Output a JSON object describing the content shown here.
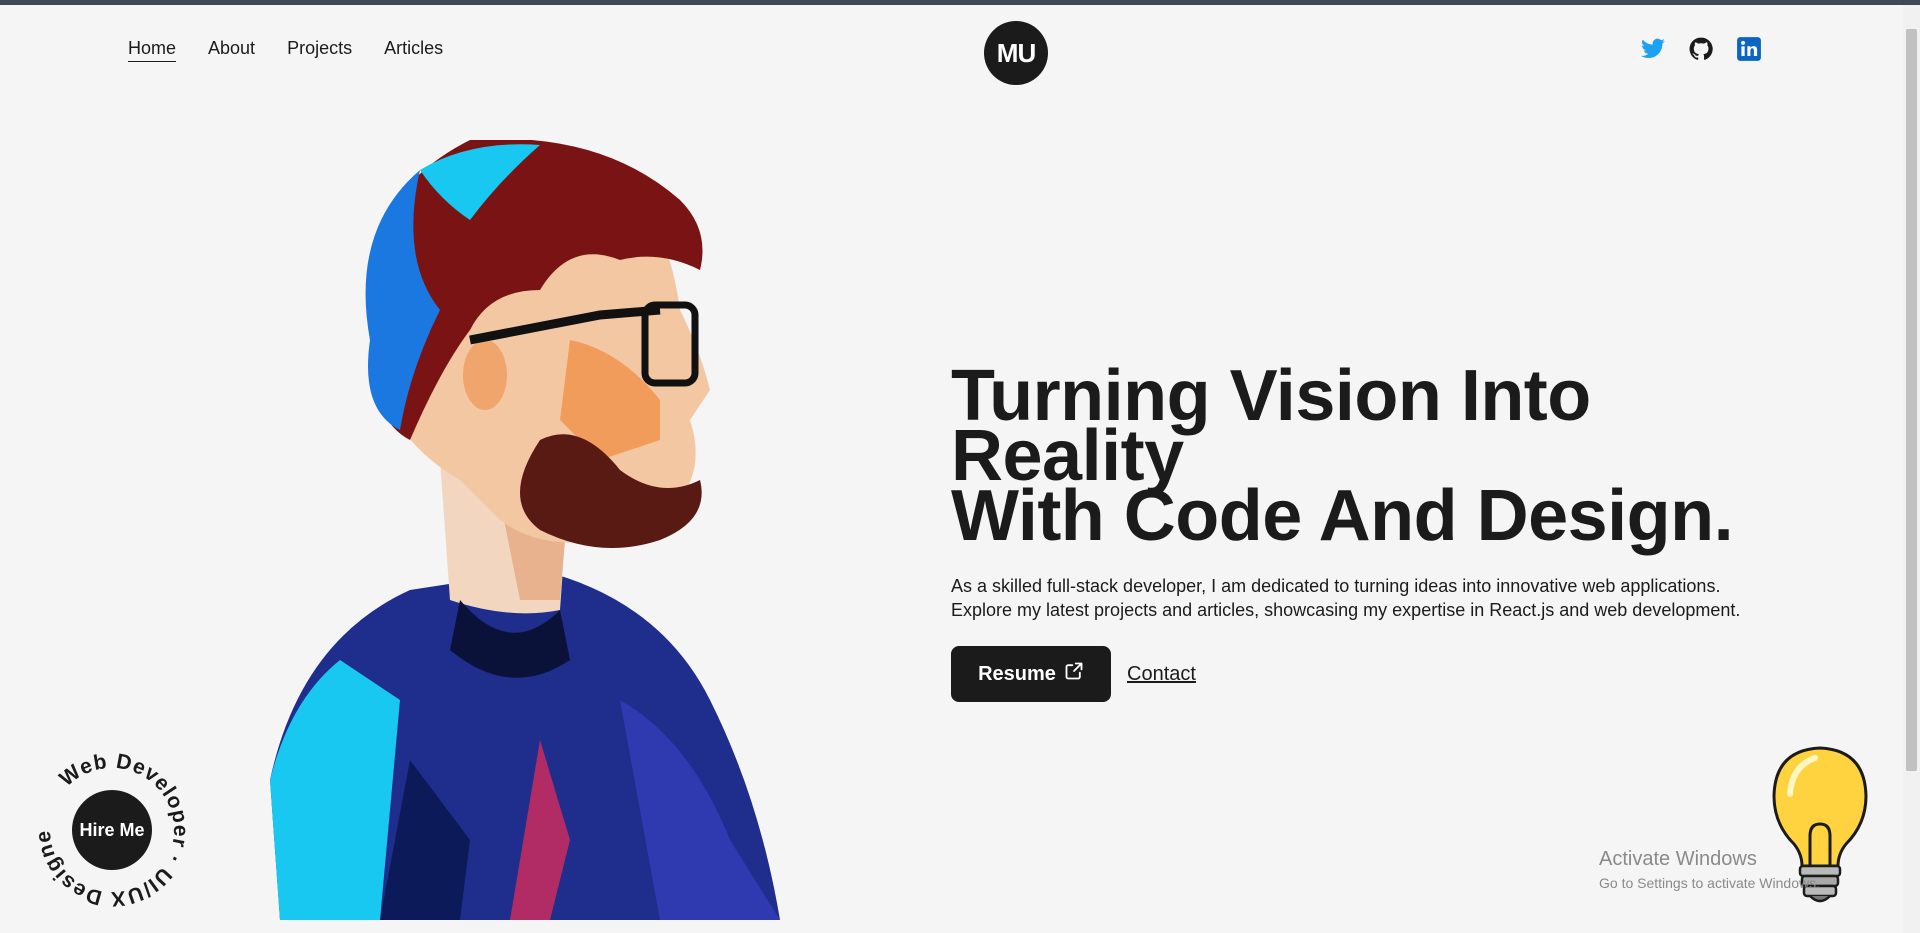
{
  "nav": {
    "items": [
      "Home",
      "About",
      "Projects",
      "Articles"
    ]
  },
  "logo": {
    "text": "MU"
  },
  "socials": [
    "twitter-icon",
    "github-icon",
    "linkedin-icon"
  ],
  "hero": {
    "title_line1": "Turning Vision Into Reality",
    "title_line2": "With Code And Design.",
    "description_line1": "As a skilled full-stack developer, I am dedicated to turning ideas into innovative web applications.",
    "description_line2": "Explore my latest projects and articles, showcasing my expertise in React.js and web development.",
    "resume_label": "Resume",
    "contact_label": "Contact"
  },
  "hire": {
    "center_label": "Hire Me",
    "ring_text": "Web Developer · UI/UX Designer ·"
  },
  "watermark": {
    "line1": "Activate Windows",
    "line2": "Go to Settings to activate Windows."
  },
  "colors": {
    "background": "#f5f5f5",
    "dark": "#1b1b1b",
    "twitter": "#1da1f2",
    "linkedin": "#0a66c2"
  }
}
